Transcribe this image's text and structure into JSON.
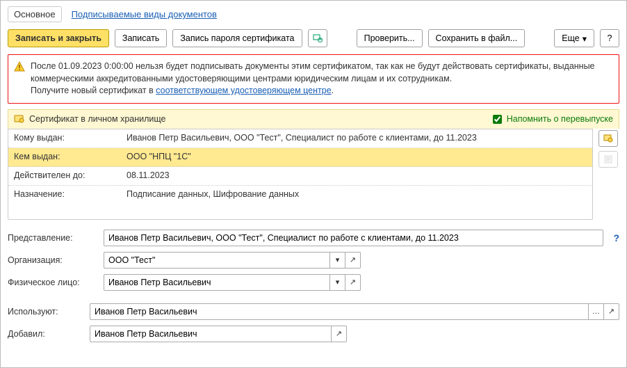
{
  "tabs": {
    "main": "Основное",
    "signed_types": "Подписываемые виды документов"
  },
  "toolbar": {
    "save_close": "Записать и закрыть",
    "save": "Записать",
    "save_password": "Запись пароля сертификата",
    "check": "Проверить...",
    "save_to_file": "Сохранить в файл...",
    "more": "Еще",
    "help": "?"
  },
  "warning": {
    "line1_a": "После 01.09.2023 0:00:00 нельзя будет подписывать документы этим сертификатом, так как не будут действовать сертификаты, выданные",
    "line1_b": "коммерческими аккредитованными удостоверяющими центрами юридическим лицам и их сотрудникам.",
    "line2_pre": "Получите новый сертификат в ",
    "line2_link": "соответствующем удостоверяющем центре",
    "line2_post": "."
  },
  "cert_header": {
    "title": "Сертификат в личном хранилище",
    "remind": "Напомнить о перевыпуске",
    "remind_checked": true
  },
  "cert": {
    "issued_to_label": "Кому выдан:",
    "issued_to": "Иванов Петр Васильевич, ООО \"Тест\", Специалист по работе с клиентами, до 11.2023",
    "issued_by_label": "Кем выдан:",
    "issued_by": "ООО \"НПЦ \"1С\"",
    "valid_to_label": "Действителен до:",
    "valid_to": "08.11.2023",
    "purpose_label": "Назначение:",
    "purpose": "Подписание данных, Шифрование данных"
  },
  "form": {
    "representation_label": "Представление:",
    "representation": "Иванов Петр Васильевич, ООО \"Тест\", Специалист по работе с клиентами, до 11.2023",
    "organization_label": "Организация:",
    "organization": "ООО \"Тест\"",
    "person_label": "Физическое лицо:",
    "person": "Иванов Петр Васильевич",
    "used_by_label": "Используют:",
    "used_by": "Иванов Петр Васильевич",
    "added_by_label": "Добавил:",
    "added_by": "Иванов Петр Васильевич"
  }
}
